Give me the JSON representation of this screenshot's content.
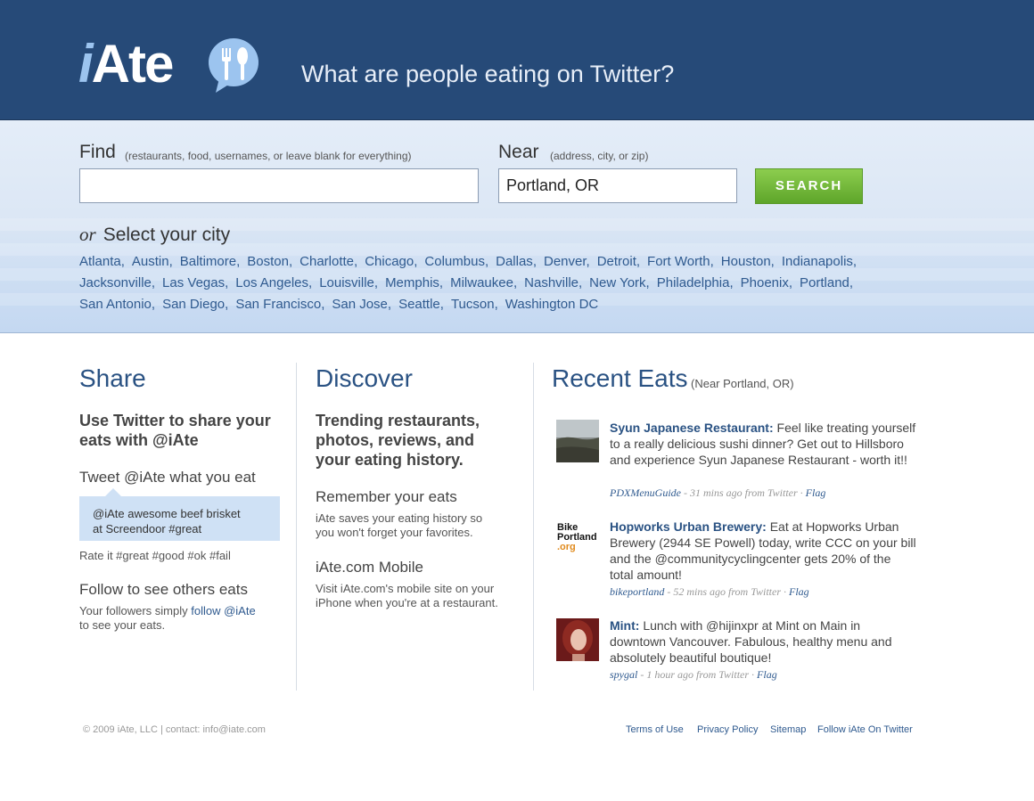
{
  "header": {
    "logo_i": "i",
    "logo_rest": "Ate",
    "tagline": "What are people eating on Twitter?"
  },
  "search": {
    "find_label": "Find",
    "find_hint": "(restaurants, food, usernames, or leave blank for everything)",
    "find_value": "",
    "near_label": "Near",
    "near_hint": "(address, city, or zip)",
    "near_value": "Portland, OR",
    "button_label": "SEARCH",
    "or_word": "or",
    "select_city_label": "Select your city",
    "cities": [
      "Atlanta",
      "Austin",
      "Baltimore",
      "Boston",
      "Charlotte",
      "Chicago",
      "Columbus",
      "Dallas",
      "Denver",
      "Detroit",
      "Fort Worth",
      "Houston",
      "Indianapolis",
      "Jacksonville",
      "Las Vegas",
      "Los Angeles",
      "Louisville",
      "Memphis",
      "Milwaukee",
      "Nashville",
      "New York",
      "Philadelphia",
      "Phoenix",
      "Portland",
      "San Antonio",
      "San Diego",
      "San Francisco",
      "San Jose",
      "Seattle",
      "Tucson",
      "Washington DC"
    ]
  },
  "share": {
    "title": "Share",
    "headline_line1": "Use Twitter to share your",
    "headline_line2": "eats with @iAte",
    "tweet_heading": "Tweet @iAte what you eat",
    "tweet_line1": "@iAte awesome beef brisket",
    "tweet_line2": "at Screendoor #great",
    "rate_text": "Rate it #great #good #ok #fail",
    "follow_heading": "Follow to see others eats",
    "follow_text_pre": "Your followers simply ",
    "follow_link": "follow @iAte",
    "follow_text_post": "to see your eats."
  },
  "discover": {
    "title": "Discover",
    "headline_line1": "Trending restaurants,",
    "headline_line2": "photos, reviews, and",
    "headline_line3": "your eating history.",
    "remember_heading": "Remember your eats",
    "remember_line1": "iAte saves your eating history so",
    "remember_line2": "you won't forget your favorites.",
    "mobile_heading": "iAte.com Mobile",
    "mobile_line1": "Visit iAte.com's mobile site on your",
    "mobile_line2": "iPhone when you're at a restaurant."
  },
  "recent": {
    "title": "Recent Eats",
    "subtitle": "(Near Portland, OR)",
    "items": [
      {
        "name": "Syun Japanese Restaurant:",
        "text": "Feel like treating yourself to a really delicious sushi dinner? Get out to Hillsboro and experience Syun Japanese Restaurant - worth it!!",
        "user": "PDXMenuGuide",
        "time": " - 31 mins ago from Twitter · ",
        "flag": "Flag",
        "avatar": "landscape-photo"
      },
      {
        "name": "Hopworks Urban Brewery:",
        "text": "Eat at Hopworks Urban Brewery (2944 SE Powell) today, write CCC on your bill and the @communitycyclingcenter gets 20% of the total amount!",
        "user": "bikeportland",
        "time": " - 52 mins ago from Twitter · ",
        "flag": "Flag",
        "avatar_line1": "Bike",
        "avatar_line2": "Portland",
        "avatar_line3": ".org"
      },
      {
        "name": "Mint:",
        "text": "Lunch with @hijinxpr at Mint on Main in downtown Vancouver. Fabulous, healthy menu and absolutely beautiful boutique!",
        "user": "spygal",
        "time": " - 1 hour ago from Twitter · ",
        "flag": "Flag",
        "avatar": "portrait-photo"
      }
    ]
  },
  "footer": {
    "copyright": "© 2009 iAte, LLC | contact: info@iate.com",
    "links": [
      "Terms of Use",
      "Privacy Policy",
      "Sitemap",
      "Follow iAte On Twitter"
    ]
  },
  "colors": {
    "header_bg": "#264a78",
    "accent_blue": "#2a5283",
    "search_green": "#6cb33a",
    "tweet_box": "#cfe1f5"
  }
}
